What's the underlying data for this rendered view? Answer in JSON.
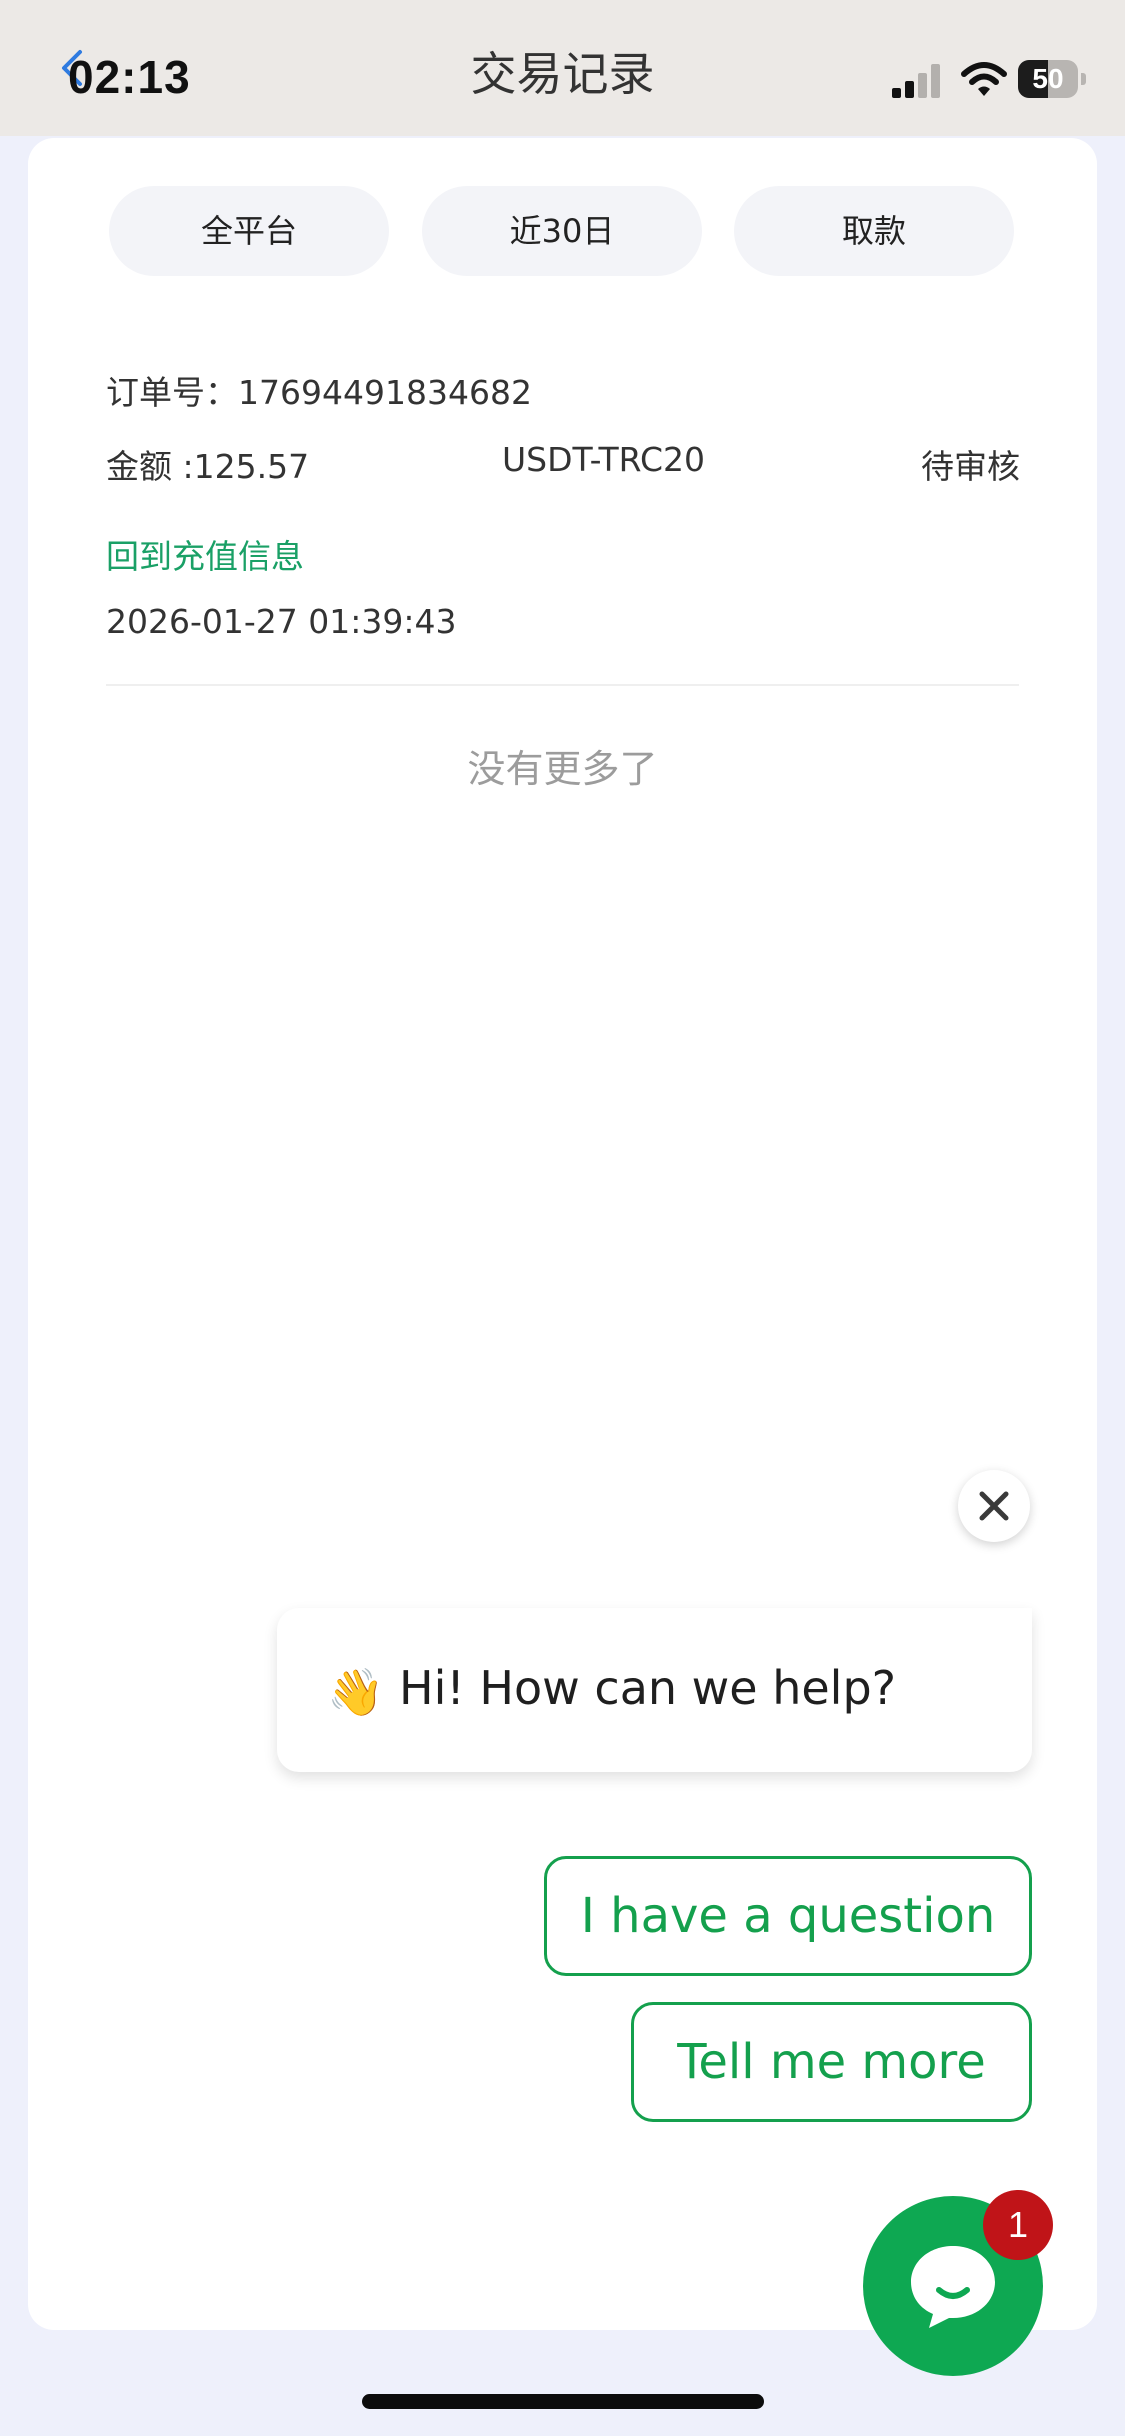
{
  "status_bar": {
    "time": "02:13",
    "battery": "50",
    "battery_level": 0.5
  },
  "header": {
    "title": "交易记录"
  },
  "filters": [
    {
      "label": "全平台"
    },
    {
      "label": "近30日"
    },
    {
      "label": "取款"
    }
  ],
  "record": {
    "order_label": "订单号：",
    "order_no": "17694491834682",
    "amount_label": "金额 :",
    "amount": "125.57",
    "currency": "USDT-TRC20",
    "status": "待审核",
    "link": "回到充值信息",
    "datetime": "2026-01-27 01:39:43"
  },
  "list_end": "没有更多了",
  "chat": {
    "greeting_emoji": "👋",
    "greeting": "Hi! How can we help?",
    "quick_replies": [
      "I have a question",
      "Tell me more"
    ],
    "unread_count": "1",
    "brand_color": "#0ea852",
    "badge_color": "#c01418"
  },
  "icons": [
    "back-chevron-icon",
    "signal-icon",
    "wifi-icon",
    "battery-icon",
    "close-icon",
    "chat-bubble-icon"
  ]
}
